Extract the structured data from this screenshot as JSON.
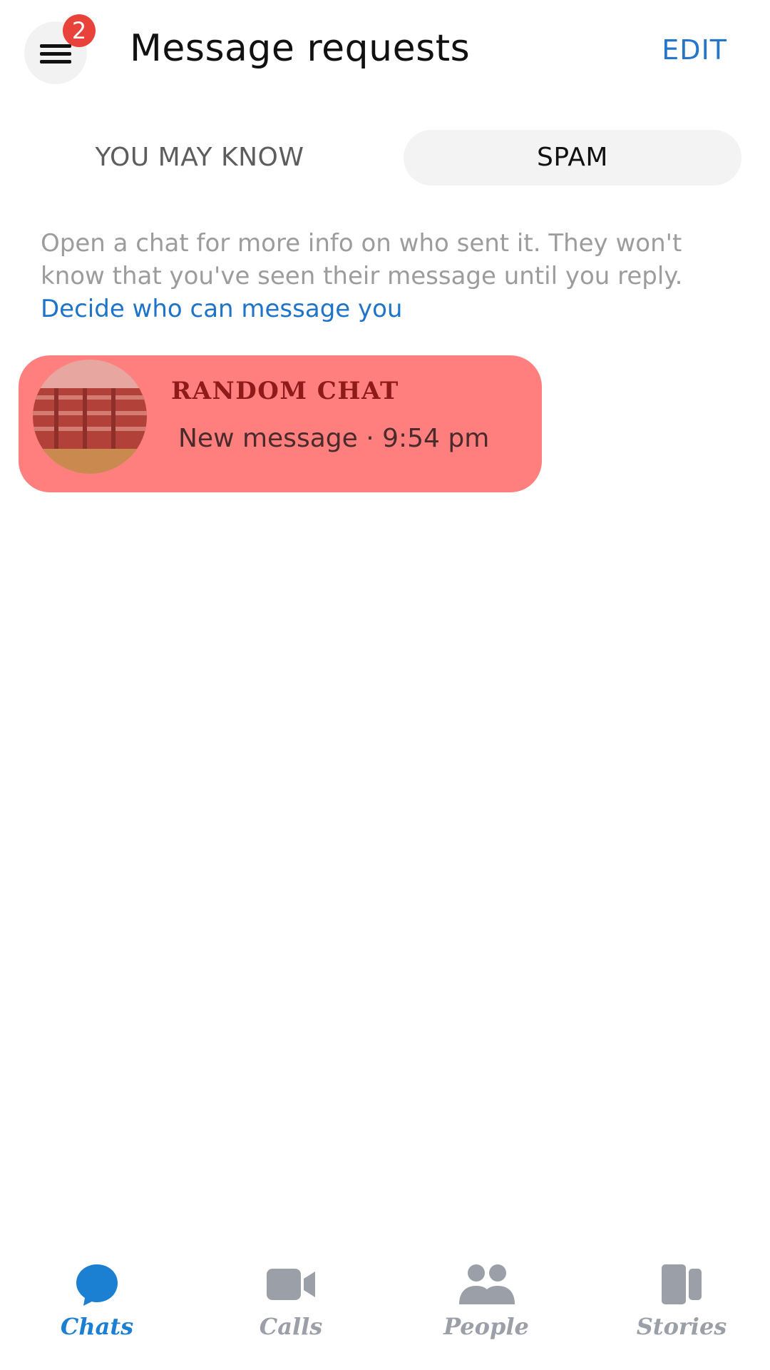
{
  "header": {
    "title": "Message requests",
    "edit_label": "EDIT",
    "menu_badge_count": "2"
  },
  "tabs": [
    {
      "label": "YOU MAY KNOW",
      "selected": false
    },
    {
      "label": "SPAM",
      "selected": true
    }
  ],
  "info": {
    "text": "Open a chat for more info on who sent it. They won't know that you've seen their message until you reply.",
    "link": "Decide who can message you"
  },
  "chats": [
    {
      "name": "RANDOM  CHAT",
      "meta": "New message · 9:54 pm",
      "highlight_color": "#ff7f7f"
    }
  ],
  "bottom_nav": [
    {
      "label": "Chats",
      "icon": "chat-bubble-icon",
      "active": true
    },
    {
      "label": "Calls",
      "icon": "video-camera-icon",
      "active": false
    },
    {
      "label": "People",
      "icon": "people-icon",
      "active": false
    },
    {
      "label": "Stories",
      "icon": "stories-icon",
      "active": false
    }
  ],
  "colors": {
    "accent": "#1b7fd2",
    "badge": "#e9423a",
    "inactive": "#9ba0a8"
  }
}
